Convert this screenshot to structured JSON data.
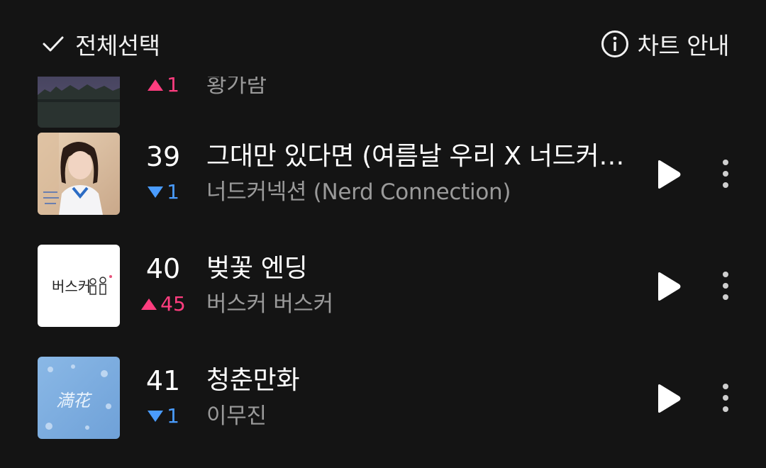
{
  "header": {
    "select_all_label": "전체선택",
    "chart_guide_label": "차트 안내"
  },
  "partial_row": {
    "change": "1",
    "change_direction": "up",
    "artist": "황가람"
  },
  "rows": [
    {
      "rank": "39",
      "change": "1",
      "change_direction": "down",
      "title": "그대만 있다면 (여름날 우리 X 너드커넥션)",
      "artist": "너드커넥션 (Nerd Connection)"
    },
    {
      "rank": "40",
      "change": "45",
      "change_direction": "up",
      "title": "벚꽃 엔딩",
      "artist": "버스커 버스커",
      "album_art_text": "버스커"
    },
    {
      "rank": "41",
      "change": "1",
      "change_direction": "down",
      "title": "청춘만화",
      "artist": "이무진",
      "album_art_text": "満花"
    }
  ],
  "colors": {
    "background": "#141414",
    "rank_up": "#ff3d7f",
    "rank_down": "#4a9cff",
    "artist_text": "#9a9a9a"
  },
  "icons": {
    "select_all": "check-icon",
    "chart_guide": "info-icon",
    "play": "play-icon",
    "more": "more-vertical-icon",
    "up": "triangle-up-icon",
    "down": "triangle-down-icon"
  }
}
